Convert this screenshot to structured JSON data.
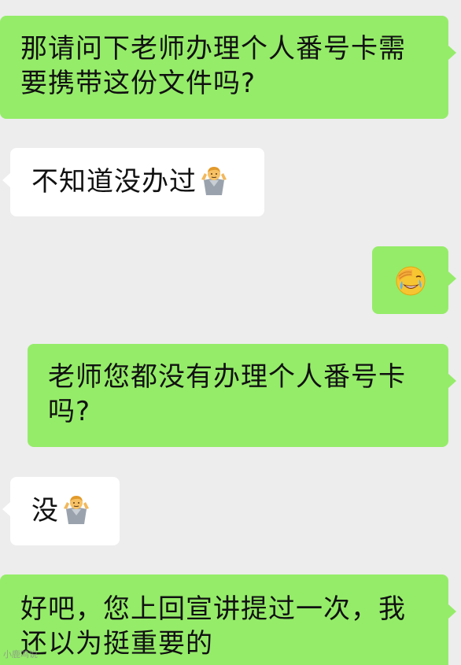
{
  "messages": [
    {
      "sender": "me",
      "text": "那请问下老师办理个人番号卡需要携带这份文件吗?"
    },
    {
      "sender": "them",
      "text": "不知道没办过",
      "emoji": "person-shrugging-emoji"
    },
    {
      "sender": "me",
      "emoji": "face-palm-crying-emoji"
    },
    {
      "sender": "me",
      "text": "老师您都没有办理个人番号卡吗?"
    },
    {
      "sender": "them",
      "text": "没",
      "emoji": "person-shrugging-emoji"
    },
    {
      "sender": "me",
      "text": "好吧，您上回宣讲提过一次，我还以为挺重要的"
    }
  ],
  "watermark": {
    "text": "小鹿鸣说"
  },
  "colors": {
    "background": "#ededed",
    "outgoing_bubble": "#95ec69",
    "incoming_bubble": "#ffffff",
    "text": "#111111"
  }
}
